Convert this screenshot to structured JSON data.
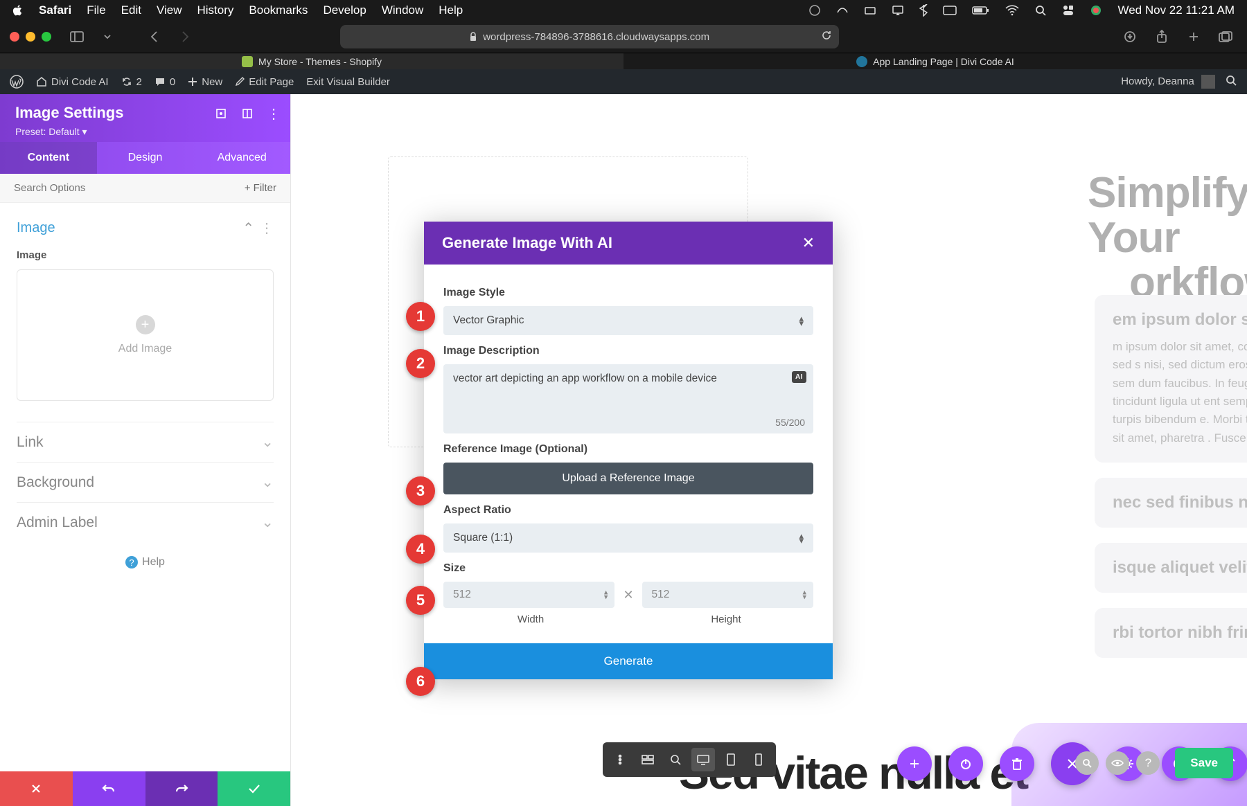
{
  "mac_menu": {
    "app": "Safari",
    "items": [
      "File",
      "Edit",
      "View",
      "History",
      "Bookmarks",
      "Develop",
      "Window",
      "Help"
    ],
    "clock": "Wed Nov 22  11:21 AM"
  },
  "safari": {
    "url": "wordpress-784896-3788616.cloudwaysapps.com"
  },
  "tabs": {
    "left": "My Store - Themes - Shopify",
    "right": "App Landing Page | Divi Code AI"
  },
  "wp": {
    "site": "Divi Code AI",
    "revisions": "2",
    "comments": "0",
    "new": "New",
    "edit": "Edit Page",
    "exit": "Exit Visual Builder",
    "howdy": "Howdy, Deanna"
  },
  "sidebar": {
    "title": "Image Settings",
    "preset": "Preset: Default",
    "tabs": [
      "Content",
      "Design",
      "Advanced"
    ],
    "search_ph": "Search Options",
    "filter": "Filter",
    "image_section": "Image",
    "image_label": "Image",
    "add_image": "Add Image",
    "accordions": [
      "Link",
      "Background",
      "Admin Label"
    ],
    "help": "Help"
  },
  "modal": {
    "title": "Generate Image With AI",
    "style_label": "Image Style",
    "style_value": "Vector Graphic",
    "desc_label": "Image Description",
    "desc_value": "vector art depicting an app workflow on a mobile device",
    "desc_count": "55/200",
    "ref_label": "Reference Image (Optional)",
    "upload": "Upload a Reference Image",
    "aspect_label": "Aspect Ratio",
    "aspect_value": "Square (1:1)",
    "size_label": "Size",
    "width_ph": "512",
    "height_ph": "512",
    "width_sub": "Width",
    "height_sub": "Height",
    "generate": "Generate"
  },
  "page": {
    "hero_l1": "Simplify Your",
    "hero_l2": "orkflows",
    "acc1_title": "em ipsum dolor sit amet",
    "acc1_body": "m ipsum dolor sit amet, consectetur adipiscing elit. Donec sed s nisi, sed dictum eros. Quisque aliquet velit sit amet sem dum faucibus. In feugiat aliquet mollis. Etiam tincidunt ligula ut ent semper. Quisque luctus lectus non turpis bibendum e. Morbi tortor nibh, fringilla sed pretium sit amet, pharetra . Fusce vel egestas nisl.",
    "acc2": "nec sed finibus nisi",
    "acc3": "isque aliquet velit sit amet",
    "acc4": "rbi tortor nibh fringilla",
    "big_h2": "Sed vitae nulla et"
  },
  "footer": {
    "save": "Save"
  },
  "bubbles": [
    "1",
    "2",
    "3",
    "4",
    "5",
    "6"
  ]
}
